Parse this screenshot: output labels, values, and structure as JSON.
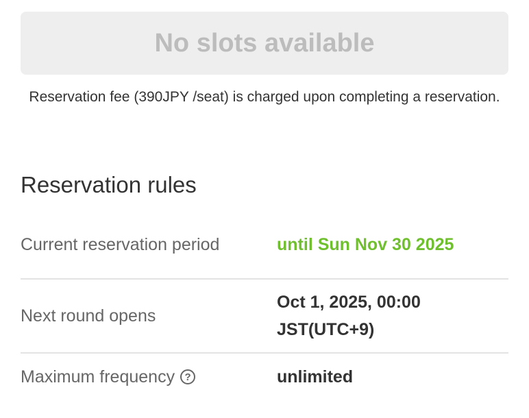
{
  "booking": {
    "no_slots_label": "No slots available",
    "fee_note": "Reservation fee (390JPY /seat) is charged upon completing a reservation."
  },
  "rules": {
    "heading": "Reservation rules",
    "rows": [
      {
        "label": "Current reservation period",
        "value": "until Sun Nov 30 2025"
      },
      {
        "label": "Next round opens",
        "value": "Oct 1, 2025, 00:00 JST(UTC+9)"
      },
      {
        "label": "Maximum frequency",
        "value": "unlimited",
        "help_icon": "?"
      }
    ]
  },
  "colors": {
    "accent": "#6fbf2e",
    "disabled_button_bg": "#eeeeee",
    "disabled_button_text": "#bcbcbc",
    "divider": "#e3e3e3"
  },
  "icons": {
    "help": "question-circle-icon"
  }
}
